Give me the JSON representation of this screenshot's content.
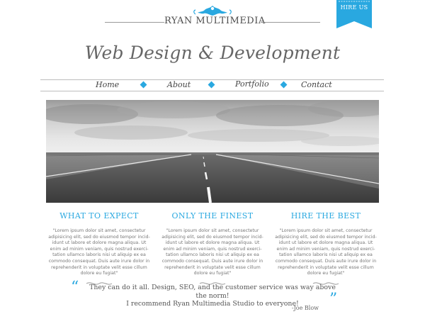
{
  "header": {
    "logo_text": "RYAN MULTIMEDIA",
    "hire_label": "HIRE US",
    "tagline": "Web Design & Development"
  },
  "nav": {
    "items": [
      {
        "label": "Home"
      },
      {
        "label": "About"
      },
      {
        "label": "Portfolio"
      },
      {
        "label": "Contact"
      }
    ]
  },
  "hero": {
    "image": "road-landscape-photo"
  },
  "columns": [
    {
      "title": "WHAT TO EXPECT",
      "text": "\"Lorem ipsum dolor sit amet, consectetur adipisicing elit, sed do eiusmod tempor incid-idunt ut labore et dolore magna aliqua. Ut enim ad minim veniam, quis nostrud exerci-tation ullamco laboris nisi ut aliquip ex ea commodo consequat. Duis aute irure dolor in reprehenderit in voluptate velit esse cillum dolore eu fugiat\""
    },
    {
      "title": "ONLY THE FINEST",
      "text": "\"Lorem ipsum dolor sit amet, consectetur adipisicing elit, sed do eiusmod tempor incid-idunt ut labore et dolore magna aliqua. Ut enim ad minim veniam, quis nostrud exerci-tation ullamco laboris nisi ut aliquip ex ea commodo consequat. Duis aute irure dolor in reprehenderit in voluptate velit esse cillum dolore eu fugiat\""
    },
    {
      "title": "HIRE THE BEST",
      "text": "\"Lorem ipsum dolor sit amet, consectetur adipisicing elit, sed do eiusmod tempor incid-idunt ut labore et dolore magna aliqua. Ut enim ad minim veniam, quis nostrud exerci-tation ullamco laboris nisi ut aliquip ex ea commodo consequat. Duis aute irure dolor in reprehenderit in voluptate velit esse cillum dolore eu fugiat\""
    }
  ],
  "testimonial": {
    "open_quote": "“",
    "close_quote": "”",
    "line1": "They can do it all. Design, SEO, and the customer service was way above the norm!",
    "line2": "I recommend Ryan Multimedia Studio to everyone!",
    "author": "-Joe Blow"
  },
  "colors": {
    "accent": "#29a8e0",
    "text": "#555555",
    "rule": "#bdbdbd"
  }
}
